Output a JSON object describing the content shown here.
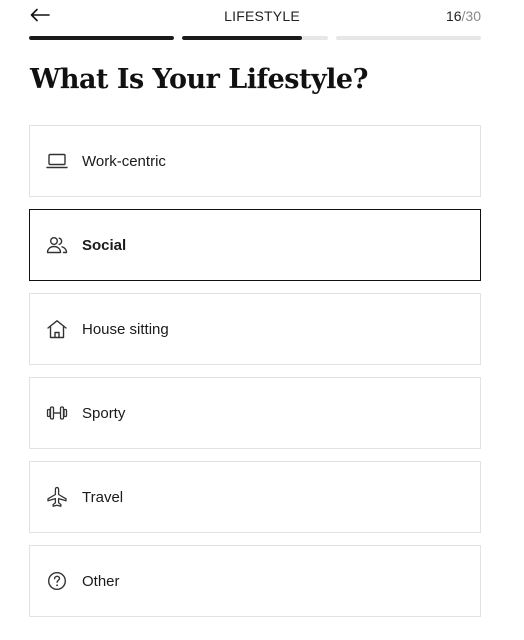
{
  "header": {
    "title": "LIFESTYLE",
    "step_current": "16",
    "step_separator": "/",
    "step_total": "30"
  },
  "progress": {
    "segments": [
      {
        "fill": 1.0
      },
      {
        "fill": 0.82
      },
      {
        "fill": 0.0
      }
    ]
  },
  "page": {
    "title": "What Is Your Lifestyle?"
  },
  "options": [
    {
      "label": "Work-centric",
      "icon": "laptop-icon",
      "selected": false
    },
    {
      "label": "Social",
      "icon": "people-icon",
      "selected": true
    },
    {
      "label": "House sitting",
      "icon": "house-icon",
      "selected": false
    },
    {
      "label": "Sporty",
      "icon": "dumbbell-icon",
      "selected": false
    },
    {
      "label": "Travel",
      "icon": "airplane-icon",
      "selected": false
    },
    {
      "label": "Other",
      "icon": "question-circle-icon",
      "selected": false
    }
  ]
}
